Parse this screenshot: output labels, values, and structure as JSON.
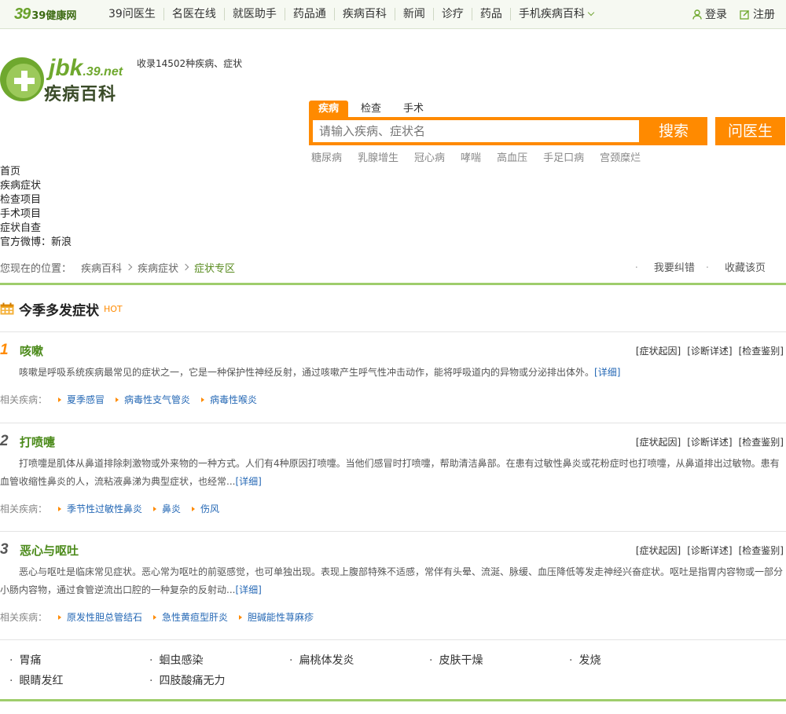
{
  "topbar": {
    "logo_num": "39",
    "logo_text": "39健康网",
    "nav": [
      "39问医生",
      "名医在线",
      "就医助手",
      "药品通",
      "疾病百科",
      "新闻",
      "诊疗",
      "药品",
      "手机疾病百科"
    ],
    "login": "登录",
    "register": "注册"
  },
  "brand": {
    "jbk": "jbk",
    "domain": ".39.net",
    "cn": "疾病百科",
    "collect": "收录14502种疾病、症状"
  },
  "search": {
    "tabs": [
      "疾病",
      "检查",
      "手术"
    ],
    "placeholder": "请输入疾病、症状名",
    "button": "搜索",
    "ask_button": "问医生",
    "hot": [
      "糖尿病",
      "乳腺增生",
      "冠心病",
      "哮喘",
      "高血压",
      "手足口病",
      "宫颈糜烂"
    ]
  },
  "leftnav": [
    "首页",
    "疾病症状",
    "检查项目",
    "手术项目",
    "症状自查",
    "官方微博：新浪"
  ],
  "breadcrumb": {
    "lead": "您现在的位置：",
    "items": [
      "疾病百科",
      "疾病症状"
    ],
    "current": "症状专区",
    "right": [
      "我要纠错",
      "收藏该页"
    ]
  },
  "section": {
    "title": "今季多发症状",
    "badge": "HOT"
  },
  "symptoms": [
    {
      "rank": "1",
      "name": "咳嗽",
      "links": [
        "[症状起因]",
        "[诊断详述]",
        "[检查鉴别]"
      ],
      "desc": "咳嗽是呼吸系统疾病最常见的症状之一，它是一种保护性神经反射，通过咳嗽产生呼气性冲击动作，能将呼吸道内的异物或分泌排出体外。",
      "more": "[详细]",
      "related_label": "相关疾病：",
      "related": [
        "夏季感冒",
        "病毒性支气管炎",
        "病毒性喉炎"
      ]
    },
    {
      "rank": "2",
      "name": "打喷嚏",
      "links": [
        "[症状起因]",
        "[诊断详述]",
        "[检查鉴别]"
      ],
      "desc": "打喷嚏是肌体从鼻道排除刺激物或外来物的一种方式。人们有4种原因打喷嚏。当他们感冒时打喷嚏，帮助清洁鼻部。在患有过敏性鼻炎或花粉症时也打喷嚏，从鼻道排出过敏物。患有血管收缩性鼻炎的人，流粘液鼻涕为典型症状，也经常...",
      "more": "[详细]",
      "related_label": "相关疾病：",
      "related": [
        "季节性过敏性鼻炎",
        "鼻炎",
        "伤风"
      ]
    },
    {
      "rank": "3",
      "name": "恶心与呕吐",
      "links": [
        "[症状起因]",
        "[诊断详述]",
        "[检查鉴别]"
      ],
      "desc": "恶心与呕吐是临床常见症状。恶心常为呕吐的前驱感觉，也可单独出现。表现上腹部特殊不适感，常伴有头晕、流涎、脉缓、血压降低等发走神经兴奋症状。呕吐是指胃内容物或一部分小肠内容物，通过食管逆流出口腔的一种复杂的反射动...",
      "more": "[详细]",
      "related_label": "相关疾病：",
      "related": [
        "原发性胆总管结石",
        "急性黄疸型肝炎",
        "胆碱能性荨麻疹"
      ]
    }
  ],
  "more_symptoms": [
    "胃痛",
    "蛔虫感染",
    "扁桃体发炎",
    "皮肤干燥",
    "发烧",
    "眼睛发红",
    "四肢酸痛无力"
  ],
  "colors": {
    "accent": "#ff8a00",
    "green": "#6fa82e",
    "link": "#2568b5"
  }
}
